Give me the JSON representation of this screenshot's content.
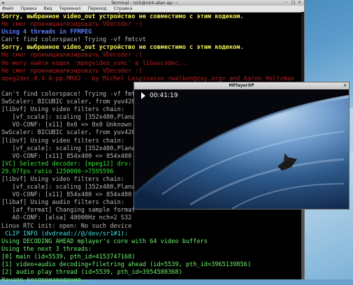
{
  "terminal": {
    "title": "Terminal - nick@nick-atan-ap: ~",
    "menu": [
      "Файл",
      "Правка",
      "Вид",
      "Терминал",
      "Переход",
      "Справка"
    ],
    "lines": [
      {
        "text": "Sorry, выбранное video_out устройство не совместимо с этим кодеком.",
        "cls": "c-yellow"
      },
      {
        "text": "Не смог проинициализировать VDecoder :(",
        "cls": "c-red"
      },
      {
        "text": "Using 4 threads in FFMPEG",
        "cls": "c-blue"
      },
      {
        "text": "Can't find colorspace! Trying -vf fmtcvt",
        "cls": "c-gray"
      },
      {
        "text": "Sorry, выбранное video_out устройство не совместимо с этим кодеком.",
        "cls": "c-yellow"
      },
      {
        "text": "Не смог проинициализировать VDecoder :(",
        "cls": "c-red"
      },
      {
        "text": "Не могу найти кодек 'mpegvideo_xvmc' в libavcodec...",
        "cls": "c-red"
      },
      {
        "text": "Не смог проинициализировать VDecoder :(",
        "cls": "c-red"
      },
      {
        "text": "mpeg2dec-0.4.0-pp.MMX2 - by Michel Lespinasse <walken@zoy.org> and Aaron Holtzman",
        "cls": "c-red"
      },
      {
        "text": "",
        "cls": "c-gray"
      },
      {
        "text": "Can't find colorspace! Trying -vf fmtcvt",
        "cls": "c-gray"
      },
      {
        "text": "SwScaler: BICUBIC scaler, from yuv420p",
        "cls": "c-gray"
      },
      {
        "text": "[libvf] Using video filters chain:",
        "cls": "c-gray"
      },
      {
        "text": "   [vf_scale]: scaling [352x480,Planar",
        "cls": "c-gray"
      },
      {
        "text": "   VO-CONF: [x11] 0x0 => 0x0 Unknown",
        "cls": "c-gray"
      },
      {
        "text": "SwScaler: BICUBIC scaler, from yuv420p",
        "cls": "c-gray"
      },
      {
        "text": "[libvf] Using video filters chain:",
        "cls": "c-gray"
      },
      {
        "text": "   [vf_scale]: scaling [352x480,Planar",
        "cls": "c-gray"
      },
      {
        "text": "   VO-CONF: [x11] 854x480 => 854x480",
        "cls": "c-gray"
      },
      {
        "text": "[VC] Selected decoder: [mpeg12] drv:",
        "cls": "c-green"
      },
      {
        "text": "29.97fps ratio 1250000->7595596",
        "cls": "c-green"
      },
      {
        "text": "[libvf] Using video filters chain:",
        "cls": "c-gray"
      },
      {
        "text": "   [vf_scale]: scaling [352x480,Planar",
        "cls": "c-gray"
      },
      {
        "text": "   VO-CONF: [x11] 854x480 => 854x480",
        "cls": "c-gray"
      },
      {
        "text": "[libaf] Using audio filters chain:",
        "cls": "c-gray"
      },
      {
        "text": "   [af_format] Changing sample format",
        "cls": "c-gray"
      },
      {
        "text": "   AO-CONF: [alsa] 48000Hz nch=2 S32",
        "cls": "c-gray"
      },
      {
        "text": "Linux RTC init: open: No such device",
        "cls": "c-gray"
      },
      {
        "text": " CLIP INFO (dvdread://@/dev/sr1#1):",
        "cls": "c-cyan"
      },
      {
        "text": "Using DECODING AHEAD mplayer's core with 64 video buffers",
        "cls": "c-ltgreen"
      },
      {
        "text": "Using the next 3 threads:",
        "cls": "c-ltgreen"
      },
      {
        "text": "[0] main (id=5539, pth_id=4153747168)",
        "cls": "c-ltgreen"
      },
      {
        "text": "[1] video+audio decoding+filetring ahead (id=5539, pth_id=3965139856)",
        "cls": "c-ltgreen"
      },
      {
        "text": "[2] audio play thread (id=5539, pth_id=3954580368)",
        "cls": "c-ltgreen"
      },
      {
        "text": "Начало воспроизведения...",
        "cls": "c-ltgreen"
      }
    ]
  },
  "player": {
    "title": "MPlayerXP",
    "time": "00:41:19"
  },
  "colors": {
    "space": "#0a0f1c",
    "earth_dark": "#1a3a66",
    "earth_light": "#6f9ccc"
  },
  "icons": {
    "play": "play-icon",
    "close": "close-icon"
  }
}
